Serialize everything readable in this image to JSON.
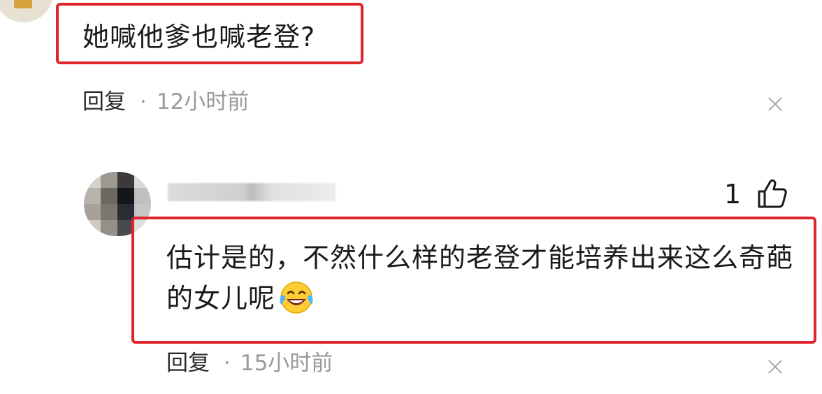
{
  "comment_1": {
    "text": "她喊他爹也喊老登?",
    "reply_label": "回复",
    "separator": "·",
    "time": "12小时前"
  },
  "comment_2": {
    "like_count": "1",
    "text": "估计是的，不然什么样的老登才能培养出来这么奇葩的女儿呢",
    "emoji": "crying-laughing-emoji",
    "reply_label": "回复",
    "separator": "·",
    "time": "15小时前"
  },
  "colors": {
    "highlight_border": "#e0242b",
    "muted_text": "#9a9a9a",
    "primary_text": "#1a1a1a"
  }
}
